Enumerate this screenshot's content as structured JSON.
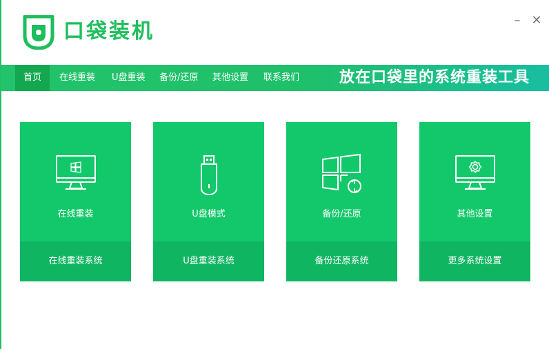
{
  "app": {
    "title": "口袋装机",
    "slogan": "放在口袋里的系统重装工具"
  },
  "window_controls": {
    "minimize": "–",
    "close": "✕"
  },
  "nav": {
    "items": [
      {
        "label": "首页",
        "active": true
      },
      {
        "label": "在线重装",
        "active": false
      },
      {
        "label": "U盘重装",
        "active": false
      },
      {
        "label": "备份/还原",
        "active": false
      },
      {
        "label": "其他设置",
        "active": false
      },
      {
        "label": "联系我们",
        "active": false
      }
    ]
  },
  "cards": [
    {
      "title": "在线重装",
      "subtitle": "在线重装系统",
      "icon": "monitor-windows-icon"
    },
    {
      "title": "U盘模式",
      "subtitle": "U盘重装系统",
      "icon": "usb-drive-icon"
    },
    {
      "title": "备份/还原",
      "subtitle": "备份还原系统",
      "icon": "windows-restore-icon"
    },
    {
      "title": "其他设置",
      "subtitle": "更多系统设置",
      "icon": "monitor-gear-icon"
    }
  ],
  "colors": {
    "brand_green": "#1fbe5d",
    "card_green": "#13c86a",
    "card_footer_green": "#10b562",
    "nav_active": "#13a84f"
  }
}
